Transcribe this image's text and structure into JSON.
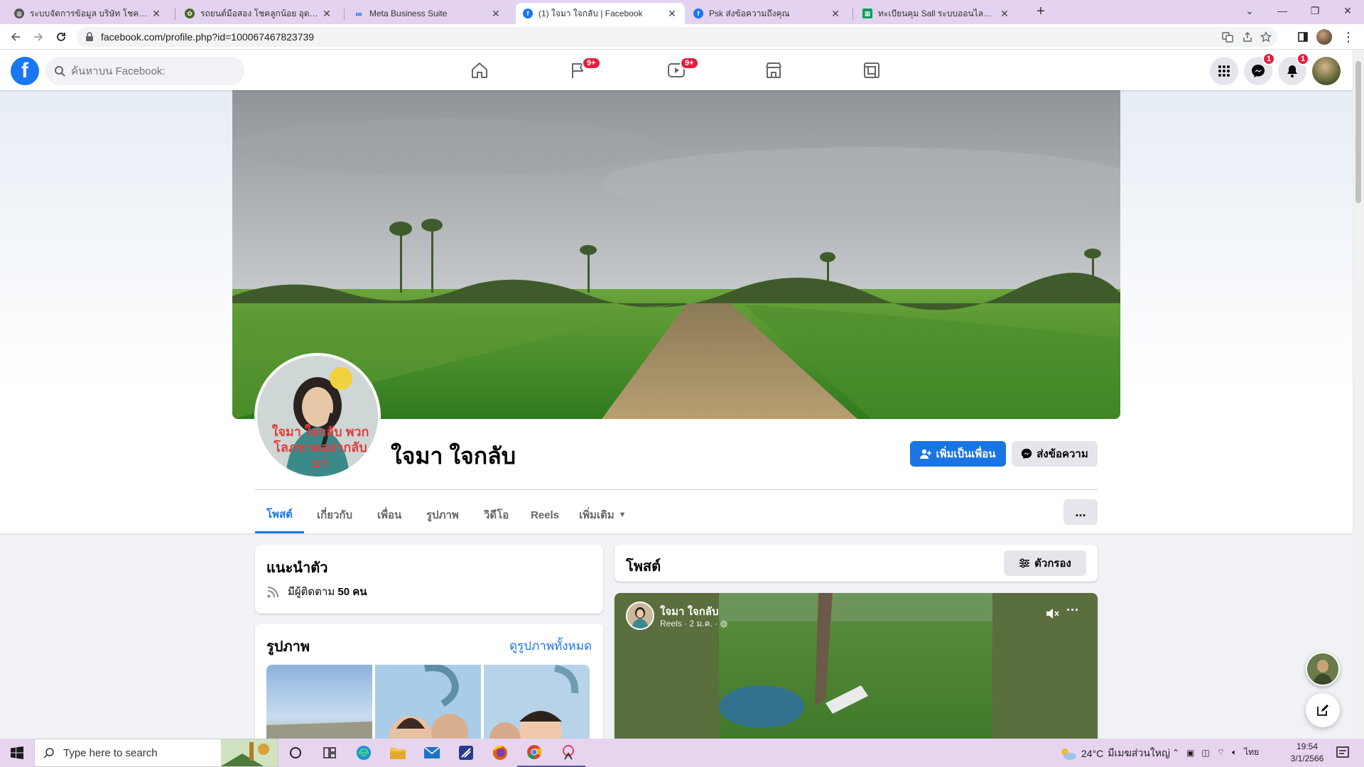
{
  "browser": {
    "tabs": [
      {
        "title": "ระบบจัดการข้อมูล บริษัท โชคลูกน้อย"
      },
      {
        "title": "รถยนต์มือสอง โชคลูกน้อย อุดรธานี"
      },
      {
        "title": "Meta Business Suite"
      },
      {
        "title": "(1) ใจมา ใจกลับ | Facebook"
      },
      {
        "title": "Psk ส่งข้อความถึงคุณ"
      },
      {
        "title": "ทะเบียนคุม Sall ระบบออนไลน์.xlsx - G"
      }
    ],
    "active_tab_index": 3,
    "url": "facebook.com/profile.php?id=100067467823739"
  },
  "facebook": {
    "search_placeholder": "ค้นหาบน Facebook:",
    "nav_badges": {
      "pages": "9+",
      "watch": "9+"
    },
    "messenger_badge": "1",
    "notifications_badge": "1"
  },
  "profile": {
    "name": "ใจมา ใจกลับ",
    "avatar_overlay_text": "ใจมา ใจกลับ พวกโลภขาดอย่ากลับมา",
    "add_friend_label": "เพิ่มเป็นเพื่อน",
    "message_label": "ส่งข้อความ",
    "tabs": [
      "โพสต์",
      "เกี่ยวกับ",
      "เพื่อน",
      "รูปภาพ",
      "วิดีโอ",
      "Reels",
      "เพิ่มเติม"
    ],
    "active_tab": 0,
    "more_menu_label": "..."
  },
  "intro": {
    "title": "แนะนำตัว",
    "followers_text": "มีผู้ติดตาม ",
    "followers_count": "50 คน"
  },
  "photos": {
    "title": "รูปภาพ",
    "see_all": "ดูรูปภาพทั้งหมด"
  },
  "posts": {
    "title": "โพสต์",
    "filter_label": "ตัวกรอง",
    "reel": {
      "author": "ใจมา ใจกลับ",
      "meta": "Reels · 2 ม.ค. · "
    }
  },
  "taskbar": {
    "search_placeholder": "Type here to search",
    "weather_temp": "24°C",
    "weather_desc": "มีเมฆส่วนใหญ่",
    "language": "ไทย",
    "time": "19:54",
    "date": "3/1/2566"
  },
  "colors": {
    "fb_blue": "#1877f2",
    "button_blue": "#1b74e4",
    "badge_red": "#e41e3f",
    "tab_strip": "#e3d3f0",
    "taskbar": "#e7d5f0"
  }
}
